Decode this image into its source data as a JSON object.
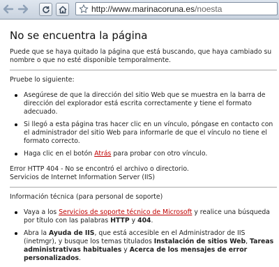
{
  "browser": {
    "url_domain": "http://www.marinacoruna.es",
    "url_path": "/noesta"
  },
  "page": {
    "title": "No se encuentra la página",
    "intro": "Puede que se haya quitado la página que está buscando, que haya cambiado su nombre o que no esté disponible temporalmente.",
    "try_heading": "Pruebe lo siguiente:",
    "tips": {
      "t1": "Asegúrese de que la dirección del sitio Web que se muestra en la barra de dirección del explorador está escrita correctamente y tiene el formato adecuado.",
      "t2": "Si llegó a esta página tras hacer clic en un vínculo, póngase en contacto con el administrador del sitio Web para informarle de que el vínculo no tiene el formato correcto.",
      "t3_pre": "Haga clic en el botón ",
      "t3_link": "Atrás",
      "t3_post": " para probar con otro vínculo."
    },
    "error_line1": "Error HTTP 404 - No se encontró el archivo o directorio.",
    "error_line2": "Servicios de Internet Information Server (IIS)",
    "tech_heading": "Información técnica (para personal de soporte)",
    "tech": {
      "b1_pre": "Vaya a los ",
      "b1_link": "Servicios de soporte técnico de Microsoft",
      "b1_mid": " y realice una búsqueda por título con las palabras ",
      "b1_bold1": "HTTP",
      "b1_and": " y ",
      "b1_bold2": "404",
      "b1_end": ".",
      "b2_pre": "Abra la ",
      "b2_bold1": "Ayuda de IIS",
      "b2_mid": ", que está accesible en el Administrador de IIS (inetmgr), y busque los temas titulados ",
      "b2_bold2": "Instalación de sitios Web",
      "b2_comma": ", ",
      "b2_bold3": "Tareas administrativas habituales",
      "b2_and": " y ",
      "b2_bold4": "Acerca de los mensajes de error personalizados",
      "b2_end": "."
    }
  },
  "icons": [
    "back-arrow-icon",
    "forward-arrow-icon",
    "reload-icon",
    "home-icon",
    "bookmark-star-icon"
  ],
  "colors": {
    "link": "#c00000",
    "toolbar": "#d3dbe6"
  }
}
